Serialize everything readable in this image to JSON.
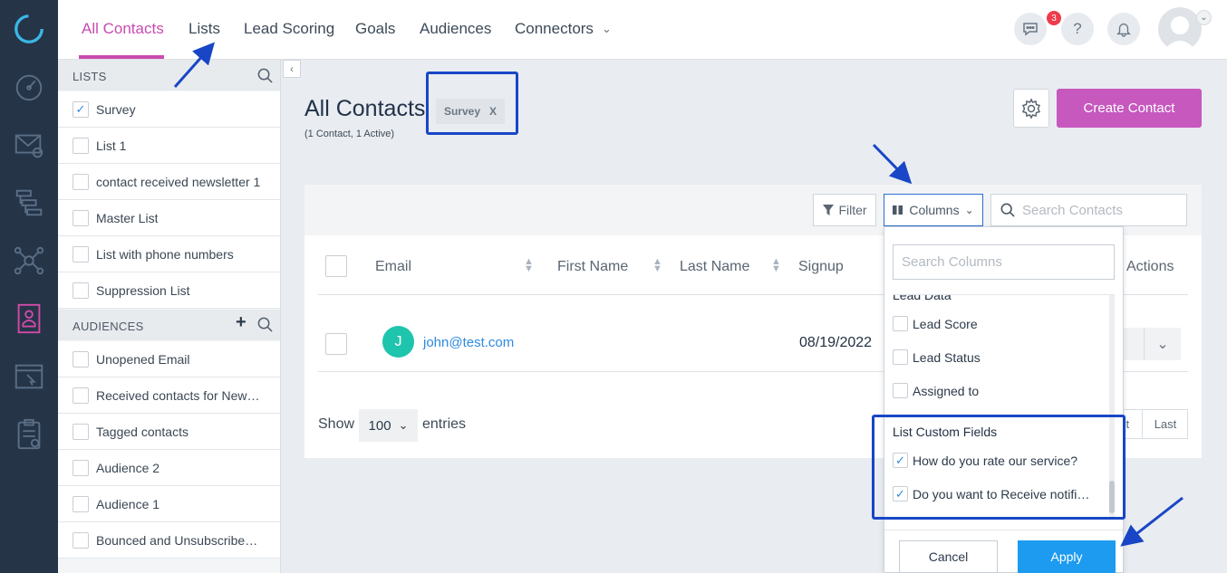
{
  "nav_tabs": [
    {
      "label": "All Contacts"
    },
    {
      "label": "Lists"
    },
    {
      "label": "Lead Scoring"
    },
    {
      "label": "Goals"
    },
    {
      "label": "Audiences"
    },
    {
      "label": "Connectors"
    }
  ],
  "header": {
    "notification_count": "3"
  },
  "sidebar": {
    "lists_heading": "LISTS",
    "lists": [
      {
        "label": "Survey",
        "checked": true
      },
      {
        "label": "List 1",
        "checked": false
      },
      {
        "label": "contact received newsletter 1",
        "checked": false
      },
      {
        "label": "Master List",
        "checked": false
      },
      {
        "label": "List with phone numbers",
        "checked": false
      },
      {
        "label": "Suppression List",
        "checked": false
      }
    ],
    "audiences_heading": "AUDIENCES",
    "audiences": [
      {
        "label": "Unopened Email"
      },
      {
        "label": "Received contacts for New…"
      },
      {
        "label": "Tagged contacts"
      },
      {
        "label": "Audience 2"
      },
      {
        "label": "Audience 1"
      },
      {
        "label": "Bounced and Unsubscribe…"
      }
    ]
  },
  "page": {
    "title": "All Contacts",
    "subtitle": "(1 Contact, 1 Active)",
    "filter_chip": "Survey",
    "filter_chip_close": "X",
    "create_button": "Create Contact"
  },
  "toolbar": {
    "filter_label": "Filter",
    "columns_label": "Columns",
    "search_placeholder": "Search Contacts"
  },
  "table": {
    "columns": [
      "Email",
      "First Name",
      "Last Name",
      "Signup",
      "Actions"
    ],
    "rows": [
      {
        "avatar_initial": "J",
        "email": "john@test.com",
        "signup": "08/19/2022"
      }
    ]
  },
  "pagination": {
    "show_label": "Show",
    "page_size": "100",
    "entries_label": "entries",
    "next_fragment": "ct",
    "last_label": "Last"
  },
  "columns_dropdown": {
    "search_placeholder": "Search Columns",
    "group_lead": "Lead Data",
    "lead_items": [
      {
        "label": "Lead Score",
        "checked": false
      },
      {
        "label": "Lead Status",
        "checked": false
      },
      {
        "label": "Assigned to",
        "checked": false
      }
    ],
    "group_custom": "List Custom Fields",
    "custom_items": [
      {
        "label": "How do you rate our service?",
        "checked": true
      },
      {
        "label": "Do you want to Receive notifi…",
        "checked": true
      }
    ],
    "cancel_label": "Cancel",
    "apply_label": "Apply"
  },
  "colors": {
    "accent_pink": "#c84bb0",
    "apply_blue": "#1d9bf0",
    "annotation_blue": "#1846c6",
    "rail_bg": "#253447"
  }
}
